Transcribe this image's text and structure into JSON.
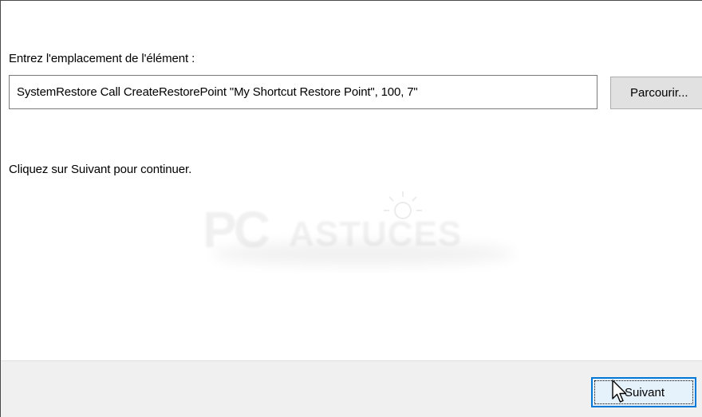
{
  "dialog": {
    "location_label": "Entrez l'emplacement de l'élément :",
    "location_value": "SystemRestore Call CreateRestorePoint \"My Shortcut Restore Point\", 100, 7\"",
    "browse_label": "Parcourir...",
    "continue_hint": "Cliquez sur Suivant pour continuer.",
    "next_label": "Suivant"
  },
  "watermark": {
    "text_pc": "PC",
    "text_astuces": "ASTUCES"
  },
  "colors": {
    "focus_border": "#0078d7",
    "button_bg": "#e1e1e1",
    "footer_bg": "#f0f0f0"
  },
  "icons": {
    "cursor": "arrow-pointer-icon",
    "watermark_logo": "pc-astuces-logo"
  }
}
